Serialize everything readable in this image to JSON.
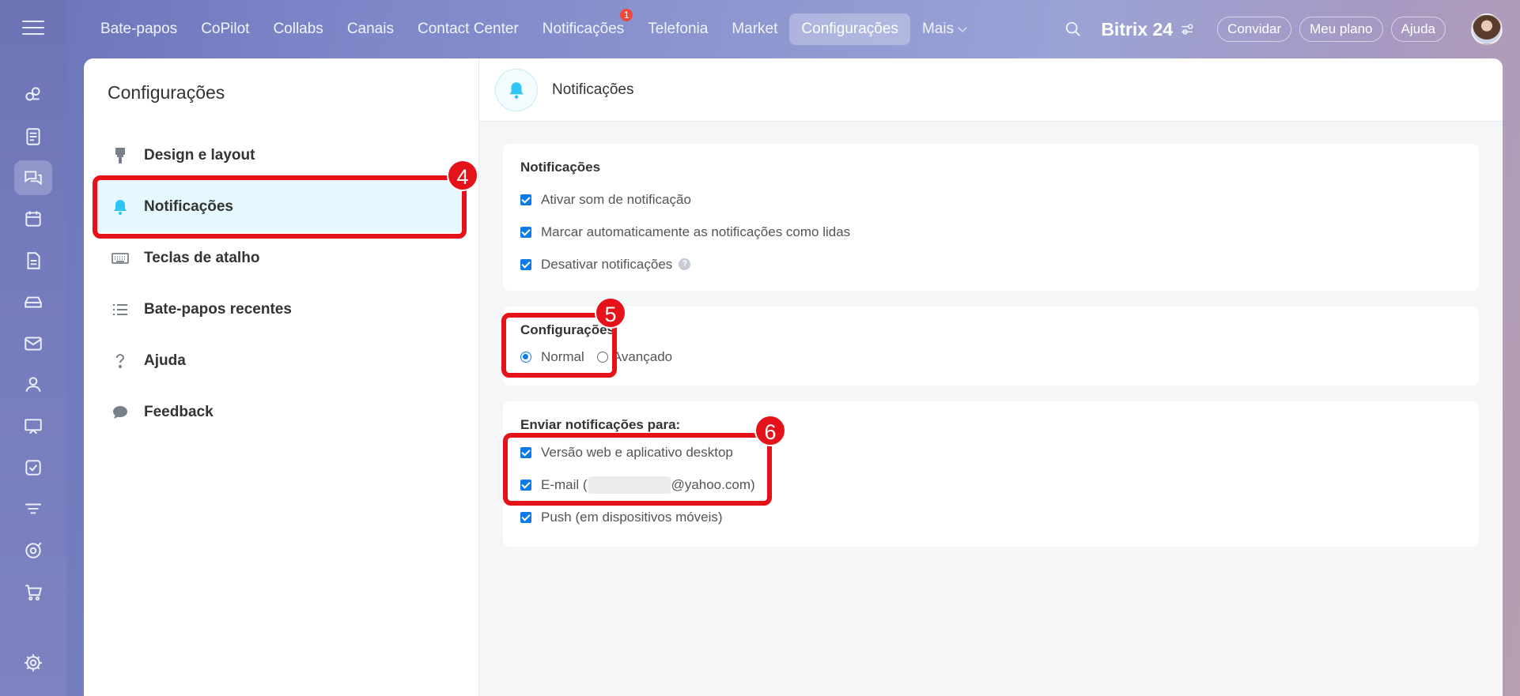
{
  "topnav": {
    "items": [
      {
        "label": "Bate-papos"
      },
      {
        "label": "CoPilot"
      },
      {
        "label": "Collabs"
      },
      {
        "label": "Canais"
      },
      {
        "label": "Contact Center"
      },
      {
        "label": "Notificações",
        "badge": "1"
      },
      {
        "label": "Telefonia"
      },
      {
        "label": "Market"
      },
      {
        "label": "Configurações",
        "active": true
      },
      {
        "label": "Mais"
      }
    ],
    "brand": "Bitrix 24",
    "invite": "Convidar",
    "plan": "Meu plano",
    "help": "Ajuda"
  },
  "rail": {
    "icons": [
      "hamburger-icon",
      "copilot-icon",
      "feed-icon",
      "chat-icon",
      "calendar-icon",
      "documents-icon",
      "drive-icon",
      "mail-icon",
      "contacts-icon",
      "workgroups-icon",
      "tasks-icon",
      "crm-icon",
      "sites-icon",
      "shop-icon",
      "settings-icon"
    ]
  },
  "sidebar": {
    "title": "Configurações",
    "items": [
      {
        "label": "Design e layout",
        "icon": "brush-icon"
      },
      {
        "label": "Notificações",
        "icon": "bell-icon",
        "active": true
      },
      {
        "label": "Teclas de atalho",
        "icon": "keyboard-icon"
      },
      {
        "label": "Bate-papos recentes",
        "icon": "list-icon"
      },
      {
        "label": "Ajuda",
        "icon": "question-icon"
      },
      {
        "label": "Feedback",
        "icon": "speech-bubble-icon"
      }
    ]
  },
  "content": {
    "header_title": "Notificações",
    "notifications": {
      "title": "Notificações",
      "options": [
        {
          "label": "Ativar som de notificação",
          "checked": true
        },
        {
          "label": "Marcar automaticamente as notificações como lidas",
          "checked": true
        },
        {
          "label": "Desativar notificações",
          "checked": true
        }
      ]
    },
    "settings": {
      "title": "Configurações",
      "normal": "Normal",
      "advanced": "Avançado",
      "selected": "Normal"
    },
    "send_to": {
      "title": "Enviar notificações para:",
      "web": "Versão web e aplicativo desktop",
      "email_prefix": "E-mail (",
      "email_suffix": "@yahoo.com)",
      "push": "Push (em dispositivos móveis)"
    }
  },
  "annotations": {
    "n4": "4",
    "n5": "5",
    "n6": "6"
  },
  "colors": {
    "accent": "#0f7ae5",
    "highlight": "#e5121a",
    "active_bg": "#e5f8fd",
    "bell": "#2fc6f6"
  }
}
